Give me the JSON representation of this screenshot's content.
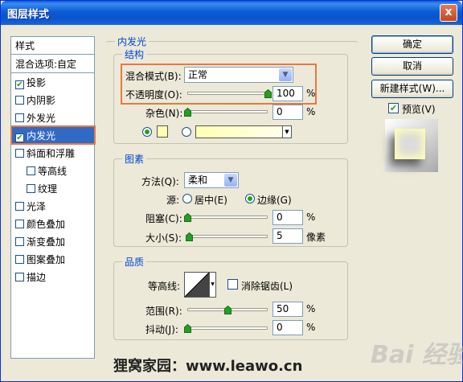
{
  "window": {
    "title": "图层样式",
    "close_label": "x"
  },
  "left_panel": {
    "header": "样式",
    "blend_options": "混合选项:自定",
    "items": [
      {
        "label": "投影",
        "checked": true,
        "selected": false,
        "indent": false
      },
      {
        "label": "内阴影",
        "checked": false,
        "selected": false,
        "indent": false
      },
      {
        "label": "外发光",
        "checked": false,
        "selected": false,
        "indent": false
      },
      {
        "label": "内发光",
        "checked": true,
        "selected": true,
        "indent": false
      },
      {
        "label": "斜面和浮雕",
        "checked": false,
        "selected": false,
        "indent": false
      },
      {
        "label": "等高线",
        "checked": false,
        "selected": false,
        "indent": true
      },
      {
        "label": "纹理",
        "checked": false,
        "selected": false,
        "indent": true
      },
      {
        "label": "光泽",
        "checked": false,
        "selected": false,
        "indent": false
      },
      {
        "label": "颜色叠加",
        "checked": false,
        "selected": false,
        "indent": false
      },
      {
        "label": "渐变叠加",
        "checked": false,
        "selected": false,
        "indent": false
      },
      {
        "label": "图案叠加",
        "checked": false,
        "selected": false,
        "indent": false
      },
      {
        "label": "描边",
        "checked": false,
        "selected": false,
        "indent": false
      }
    ]
  },
  "main": {
    "section_title": "内发光",
    "structure": {
      "title": "结构",
      "blend_mode_label": "混合模式(B):",
      "blend_mode_value": "正常",
      "opacity_label": "不透明度(O):",
      "opacity_value": "100",
      "opacity_level": 100,
      "noise_label": "杂色(N):",
      "noise_value": "0",
      "noise_level": 0,
      "percent": "%",
      "color_swatch": "#ffffb4"
    },
    "elements": {
      "title": "图素",
      "method_label": "方法(Q):",
      "method_value": "柔和",
      "source_label": "源:",
      "source_center": "居中(E)",
      "source_edge": "边缘(G)",
      "choke_label": "阻塞(C):",
      "choke_value": "0",
      "choke_level": 0,
      "size_label": "大小(S):",
      "size_value": "5",
      "size_level": 2,
      "size_unit": "像素"
    },
    "quality": {
      "title": "品质",
      "contour_label": "等高线:",
      "anti_alias_label": "消除锯齿(L)",
      "range_label": "范围(R):",
      "range_value": "50",
      "range_level": 50,
      "jitter_label": "抖动(J):",
      "jitter_value": "0",
      "jitter_level": 0
    }
  },
  "buttons": {
    "ok": "确定",
    "cancel": "取消",
    "new_style": "新建样式(W)...",
    "preview": "预览(V)"
  },
  "watermark": "狸窝家园：www.leawo.cn",
  "watermark_logo": "Bai 经验"
}
